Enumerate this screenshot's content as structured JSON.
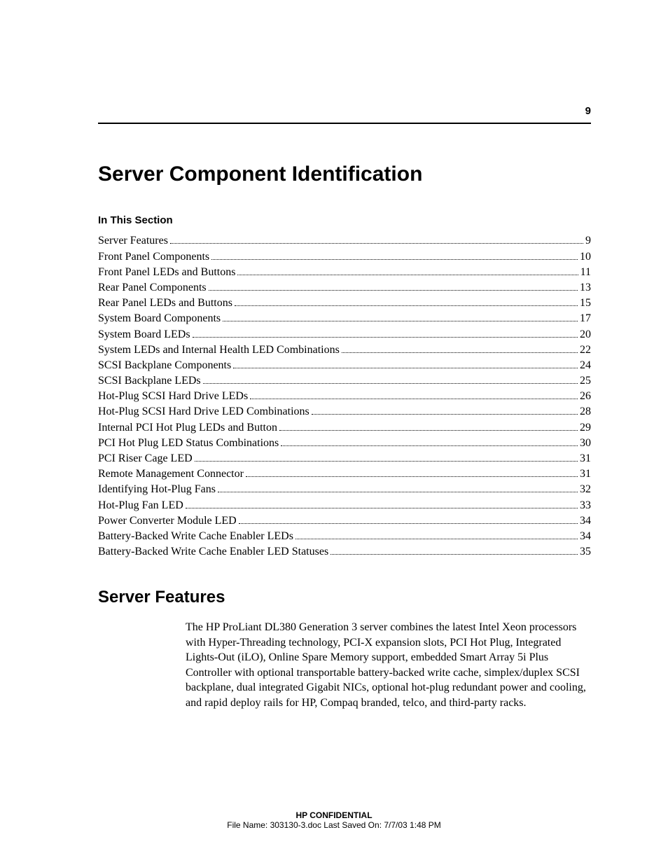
{
  "page_number": "9",
  "chapter_title": "Server Component Identification",
  "in_this_section_label": "In This Section",
  "toc": [
    {
      "title": "Server Features",
      "page": "9"
    },
    {
      "title": "Front Panel Components",
      "page": "10"
    },
    {
      "title": "Front Panel LEDs and Buttons",
      "page": "11"
    },
    {
      "title": "Rear Panel Components",
      "page": "13"
    },
    {
      "title": "Rear Panel LEDs and Buttons",
      "page": "15"
    },
    {
      "title": "System Board Components",
      "page": "17"
    },
    {
      "title": "System Board LEDs",
      "page": "20"
    },
    {
      "title": "System LEDs and Internal Health LED Combinations",
      "page": "22"
    },
    {
      "title": "SCSI Backplane Components",
      "page": "24"
    },
    {
      "title": "SCSI Backplane LEDs",
      "page": "25"
    },
    {
      "title": "Hot-Plug SCSI Hard Drive LEDs",
      "page": "26"
    },
    {
      "title": "Hot-Plug SCSI Hard Drive LED Combinations",
      "page": "28"
    },
    {
      "title": "Internal PCI Hot Plug LEDs and Button",
      "page": "29"
    },
    {
      "title": "PCI Hot Plug LED Status Combinations",
      "page": "30"
    },
    {
      "title": "PCI Riser Cage LED",
      "page": "31"
    },
    {
      "title": "Remote Management Connector",
      "page": "31"
    },
    {
      "title": "Identifying Hot-Plug Fans",
      "page": "32"
    },
    {
      "title": "Hot-Plug Fan LED",
      "page": "33"
    },
    {
      "title": "Power Converter Module LED",
      "page": "34"
    },
    {
      "title": "Battery-Backed Write Cache Enabler LEDs",
      "page": "34"
    },
    {
      "title": "Battery-Backed Write Cache Enabler LED Statuses",
      "page": "35"
    }
  ],
  "section_heading": "Server Features",
  "section_body": "The HP ProLiant DL380 Generation 3 server combines the latest Intel Xeon processors with Hyper-Threading technology, PCI-X expansion slots, PCI Hot Plug, Integrated Lights-Out (iLO), Online Spare Memory support, embedded Smart Array 5i Plus Controller with optional transportable battery-backed write cache, simplex/duplex SCSI backplane, dual integrated Gigabit NICs, optional hot-plug redundant power and cooling, and rapid deploy rails for HP, Compaq branded, telco, and third-party racks.",
  "footer": {
    "confidential": "HP CONFIDENTIAL",
    "fileinfo": "File Name: 303130-3.doc   Last Saved On: 7/7/03 1:48 PM"
  }
}
